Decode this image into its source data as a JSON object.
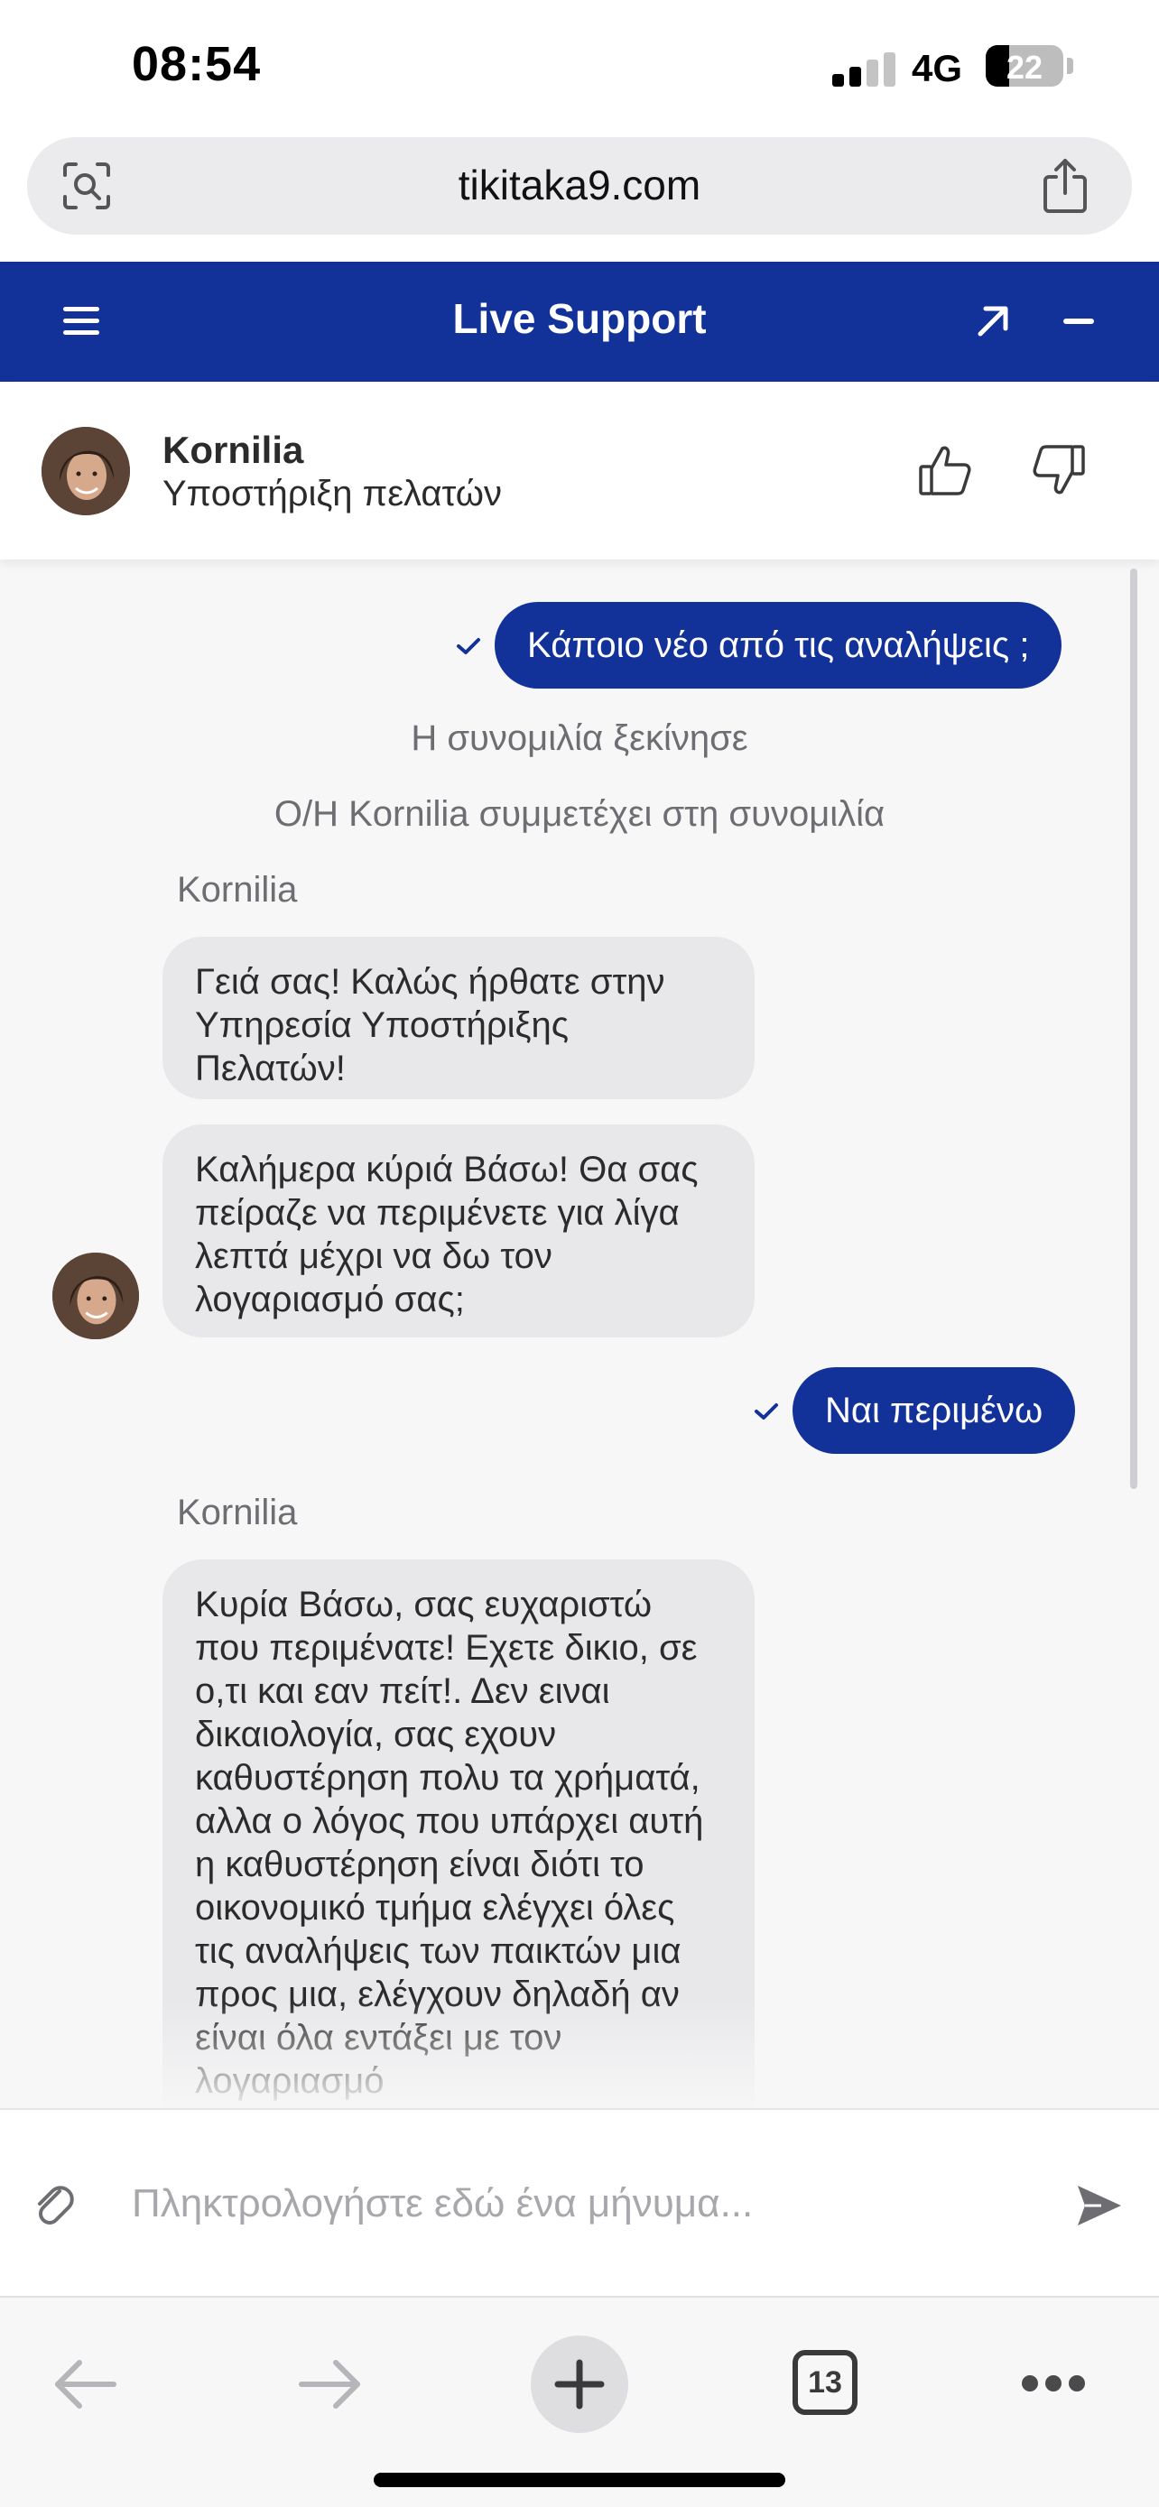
{
  "status_bar": {
    "time": "08:54",
    "network": "4G",
    "battery_level": "22"
  },
  "browser": {
    "url": "tikitaka9.com",
    "open_tabs": "13"
  },
  "header": {
    "title": "Live Support"
  },
  "agent": {
    "name": "Kornilia",
    "role": "Υποστήριξη πελατών"
  },
  "messages": {
    "user_1": "Κάποιο νέο από τις αναλήψεις ;",
    "system_1": "Η συνομιλία ξεκίνησε",
    "system_2": "O/H Kornilia συμμετέχει στη συνομιλία",
    "sender_1": "Kornilia",
    "agent_1": "Γειά σας! Καλώς ήρθατε στην Υπηρεσία Υποστήριξης Πελατών!",
    "agent_2": "Καλήμερα κύριά Βάσω! Θα σας πείραζε να περιμένετε για λίγα λεπτά μέχρι να δω τον λογαριασμό σας;",
    "user_2": "Ναι περιμένω",
    "sender_2": "Kornilia",
    "agent_3": "Κυρία Βάσω, σας ευχαριστώ που περιμένατε! Εχετε δικιο, σε ο,τι και εαν πείτ!. Δεν ειναι δικαιολογία, σας εχουν καθυστέρηση πολυ τα χρήματά, αλλα ο  λόγος που υπάρχει αυτή η καθυστέρηση είναι διότι το οικονομικό τμήμα ελέγχει όλες τις αναλήψεις των παικτών μια προς μια, ελέγχουν δηλαδή αν είναι όλα εντάξει με τον λογαριασμό"
  },
  "composer": {
    "placeholder": "Πληκτρολογήστε εδώ ένα μήνυμα..."
  },
  "colors": {
    "brand": "#12329a",
    "incoming_bubble": "#e8e8ea"
  }
}
